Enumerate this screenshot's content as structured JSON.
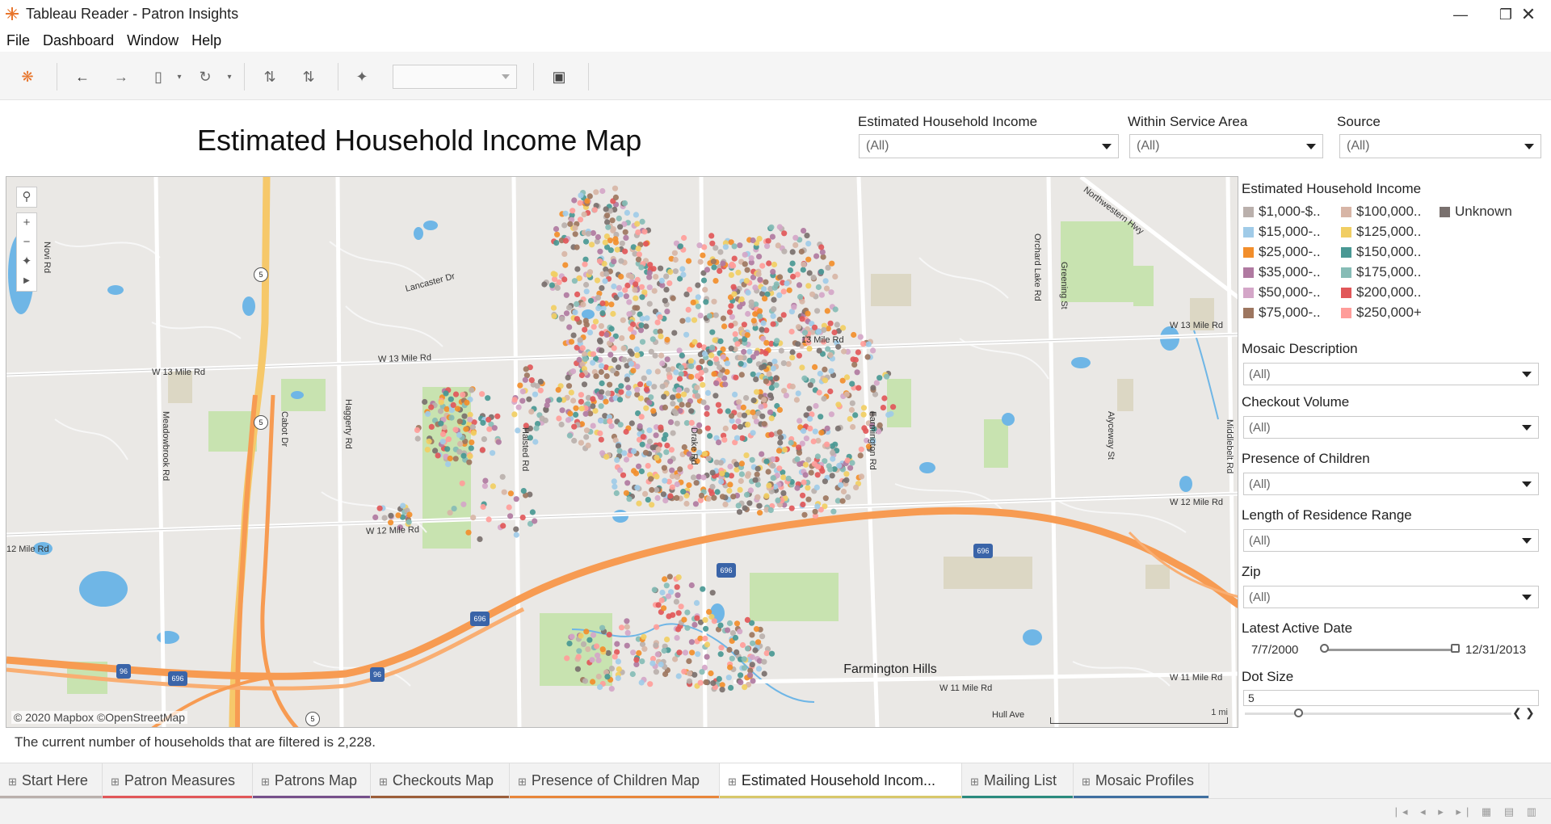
{
  "window": {
    "title": "Tableau Reader - Patron Insights"
  },
  "menu": [
    "File",
    "Dashboard",
    "Window",
    "Help"
  ],
  "dashboard": {
    "title": "Estimated Household Income Map",
    "footer_note": "The current number of households that are filtered is 2,228."
  },
  "top_filters": [
    {
      "label": "Estimated Household Income",
      "value": "(All)"
    },
    {
      "label": "Within Service Area",
      "value": "(All)"
    },
    {
      "label": "Source",
      "value": "(All)"
    }
  ],
  "legend": {
    "title": "Estimated Household Income",
    "items": [
      {
        "label": "$1,000-$..",
        "color": "#bab0ac"
      },
      {
        "label": "$15,000-..",
        "color": "#a0cbe8"
      },
      {
        "label": "$25,000-..",
        "color": "#f28e2b"
      },
      {
        "label": "$35,000-..",
        "color": "#b07aa1"
      },
      {
        "label": "$50,000-..",
        "color": "#d4a6c8"
      },
      {
        "label": "$75,000-..",
        "color": "#9d7660"
      },
      {
        "label": "$100,000..",
        "color": "#d7b5a6"
      },
      {
        "label": "$125,000..",
        "color": "#f1ce63"
      },
      {
        "label": "$150,000..",
        "color": "#499894"
      },
      {
        "label": "$175,000..",
        "color": "#86bcb6"
      },
      {
        "label": "$200,000..",
        "color": "#e15759"
      },
      {
        "label": "$250,000+",
        "color": "#ff9d9a"
      },
      {
        "label": "Unknown",
        "color": "#79706e"
      }
    ]
  },
  "side_filters": [
    {
      "label": "Mosaic Description",
      "value": "(All)"
    },
    {
      "label": "Checkout Volume",
      "value": "(All)"
    },
    {
      "label": "Presence of Children",
      "value": "(All)"
    },
    {
      "label": "Length of Residence Range",
      "value": "(All)"
    },
    {
      "label": "Zip",
      "value": "(All)"
    }
  ],
  "date_filter": {
    "label": "Latest Active Date",
    "start": "7/7/2000",
    "end": "12/31/2013"
  },
  "dot_size": {
    "label": "Dot Size",
    "value": "5",
    "level": 0.2
  },
  "map": {
    "attribution": "© 2020 Mapbox ©OpenStreetMap",
    "scale": "1 mi",
    "roads": {
      "w13_left": "W 13 Mile Rd",
      "w13_mid": "W 13 Mile Rd",
      "w13_right": "W 13 Mile Rd",
      "w12_left": "12 Mile Rd",
      "w12_mid": "W 12 Mile Rd",
      "w12_right": "W 12 Mile Rd",
      "w11_mid": "W 11 Mile Rd",
      "w11_right": "W 11 Mile Rd",
      "novi": "Novi Rd",
      "meadowbrook": "Meadowbrook Rd",
      "cabot": "Cabot Dr",
      "haggerty": "Haggerty Rd",
      "halsted": "Halsted Rd",
      "drake": "Drake Rd",
      "farmington": "Farmington Rd",
      "orchard": "Orchard Lake Rd",
      "greening": "Greening St",
      "alyceway": "Alyceway St",
      "middlebelt": "Middlebelt Rd",
      "northwestern": "Northwestern Hwy",
      "lancaster": "Lancaster Dr",
      "hull": "Hull Ave",
      "thirteen_short": "13 Mile Rd"
    },
    "place": "Farmington Hills",
    "highway_shields": [
      "5",
      "5",
      "5",
      "96",
      "96",
      "696",
      "696",
      "696",
      "696"
    ]
  },
  "tabs": [
    {
      "label": "Start Here",
      "color": "#bab0ac"
    },
    {
      "label": "Patron Measures",
      "color": "#e15759"
    },
    {
      "label": "Patrons Map",
      "color": "#76508a"
    },
    {
      "label": "Checkouts Map",
      "color": "#9c5e3a"
    },
    {
      "label": "Presence of Children Map",
      "color": "#e8863a"
    },
    {
      "label": "Estimated Household Incom...",
      "color": "#d8c86a"
    },
    {
      "label": "Mailing List",
      "color": "#2a8a7e"
    },
    {
      "label": "Mosaic Profiles",
      "color": "#3f6fa0"
    }
  ]
}
